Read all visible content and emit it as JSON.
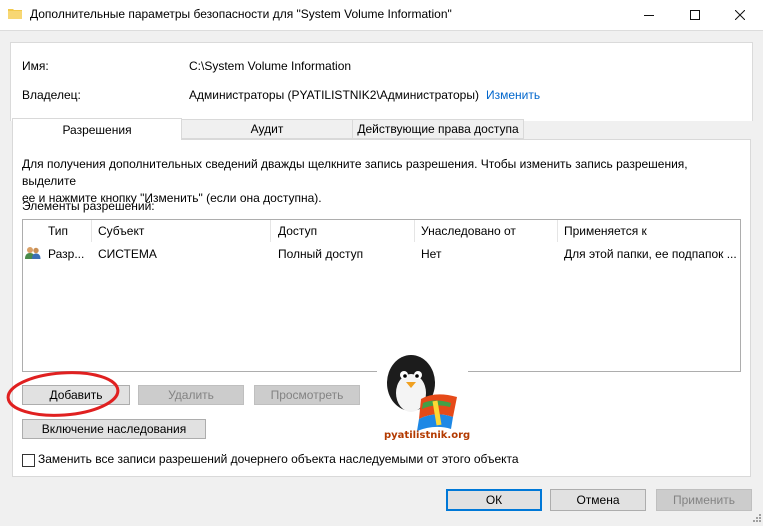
{
  "window": {
    "title": "Дополнительные параметры безопасности  для \"System Volume Information\""
  },
  "props": {
    "name_label": "Имя:",
    "name_value": "C:\\System Volume Information",
    "owner_label": "Владелец:",
    "owner_value": "Администраторы (PYATILISTNIK2\\Администраторы)",
    "owner_change_link": "Изменить"
  },
  "tabs": [
    {
      "label": "Разрешения",
      "active": true
    },
    {
      "label": "Аудит",
      "active": false
    },
    {
      "label": "Действующие права доступа",
      "active": false
    }
  ],
  "permissions": {
    "info_line1": "Для получения дополнительных сведений дважды щелкните запись разрешения. Чтобы изменить запись разрешения, выделите",
    "info_line2": "ее и нажмите кнопку \"Изменить\" (если она доступна).",
    "entries_label": "Элементы разрешений:",
    "columns": [
      "Тип",
      "Субъект",
      "Доступ",
      "Унаследовано от",
      "Применяется к"
    ],
    "rows": [
      {
        "type": "Разр...",
        "subject": "СИСТЕМА",
        "access": "Полный доступ",
        "inherited": "Нет",
        "applies_to": "Для этой папки, ее подпапок ..."
      }
    ],
    "add_button": "Добавить",
    "remove_button": "Удалить",
    "view_button": "Просмотреть",
    "inheritance_button": "Включение наследования",
    "replace_checkbox_label": "Заменить все записи разрешений дочернего объекта наследуемыми от этого объекта",
    "replace_checked": false
  },
  "footer": {
    "ok": "ОК",
    "cancel": "Отмена",
    "apply": "Применить"
  },
  "watermark": {
    "text": "pyatilistnik.org"
  },
  "colors": {
    "link": "#0066cc",
    "highlight_ellipse": "#e02020",
    "ok_border": "#0078d7"
  },
  "icons": [
    "folder-icon",
    "minimize-icon",
    "maximize-icon",
    "close-icon",
    "users-icon",
    "size-grip-icon"
  ]
}
